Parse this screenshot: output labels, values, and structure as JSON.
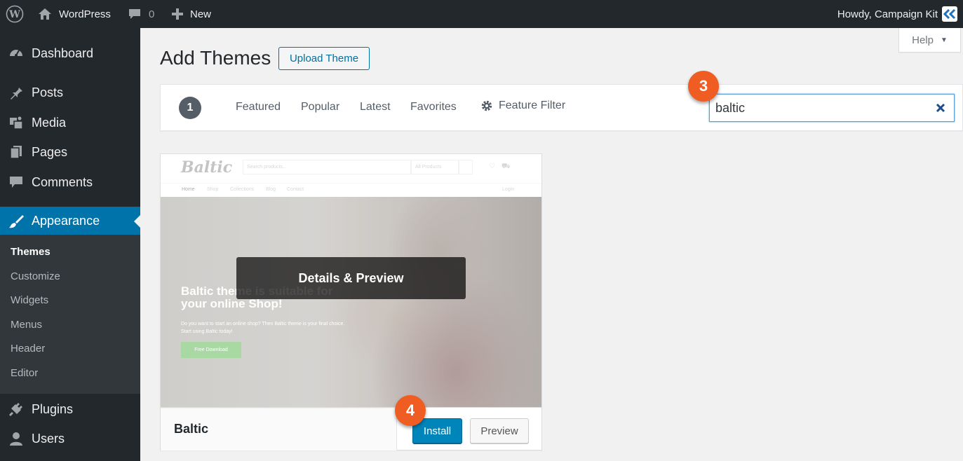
{
  "admin_bar": {
    "site_name": "WordPress",
    "comments_count": "0",
    "new_label": "New",
    "howdy": "Howdy, Campaign Kit",
    "icons": [
      "wordpress-logo",
      "home",
      "comment-bubble",
      "plus",
      "campaign-kit-logo"
    ]
  },
  "sidebar": {
    "items": [
      {
        "label": "Dashboard",
        "icon": "gauge"
      },
      {
        "label": "Posts",
        "icon": "pushpin"
      },
      {
        "label": "Media",
        "icon": "media"
      },
      {
        "label": "Pages",
        "icon": "pages"
      },
      {
        "label": "Comments",
        "icon": "comment-bubble"
      },
      {
        "label": "Appearance",
        "icon": "paintbrush",
        "active": true
      },
      {
        "label": "Plugins",
        "icon": "plug"
      },
      {
        "label": "Users",
        "icon": "user"
      }
    ],
    "submenu": [
      {
        "label": "Themes",
        "current": true
      },
      {
        "label": "Customize"
      },
      {
        "label": "Widgets"
      },
      {
        "label": "Menus"
      },
      {
        "label": "Header"
      },
      {
        "label": "Editor"
      }
    ]
  },
  "help_tab": {
    "label": "Help"
  },
  "page": {
    "title": "Add Themes",
    "upload_button": "Upload Theme"
  },
  "filter_bar": {
    "count": "1",
    "links": [
      "Featured",
      "Popular",
      "Latest",
      "Favorites"
    ],
    "feature_filter": "Feature Filter",
    "search_value": "baltic"
  },
  "steps": {
    "search": "3",
    "install": "4"
  },
  "theme_card": {
    "name": "Baltic",
    "details_label": "Details & Preview",
    "install_label": "Install",
    "preview_label": "Preview",
    "screenshot": {
      "logo": "Baltic",
      "search_placeholder": "Search products...",
      "category": "All Products",
      "nav": [
        "Home",
        "Shop",
        "Collections",
        "Blog",
        "Contact"
      ],
      "login": "Login",
      "hero_title_line1": "Baltic theme is suitable for",
      "hero_title_line2": "your online Shop!",
      "hero_sub_line1": "Do you want to start an online shop? Then Baltic theme is your final choice.",
      "hero_sub_line2": "Start using Baltic today!",
      "hero_button": "Free Download"
    }
  },
  "colors": {
    "admin_bg": "#23282d",
    "active_menu": "#0073aa",
    "primary_button": "#0085ba",
    "step_badge": "#f05d23"
  }
}
